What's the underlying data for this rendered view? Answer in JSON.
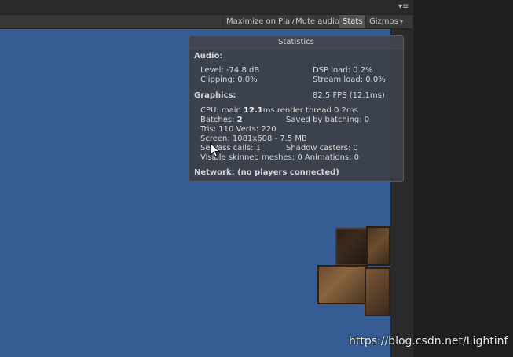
{
  "toolbar": {
    "maximize_label": "Maximize on Play",
    "mute_label": "Mute audio",
    "stats_label": "Stats",
    "gizmos_label": "Gizmos",
    "dropdown_glyph": "▾",
    "menu_glyph": "▾≡"
  },
  "stats": {
    "title": "Statistics",
    "audio": {
      "header": "Audio:",
      "level": "Level: -74.8 dB",
      "dsp": "DSP load: 0.2%",
      "clipping": "Clipping: 0.0%",
      "stream": "Stream load: 0.0%"
    },
    "graphics": {
      "header": "Graphics:",
      "fps": "82.5 FPS (12.1ms)",
      "cpu_prefix": "CPU: main ",
      "cpu_value": "12.1",
      "cpu_suffix": "ms  render thread 0.2ms",
      "batches_prefix": "Batches: ",
      "batches_value": "2",
      "saved": "Saved by batching: 0",
      "tris": "Tris: 110  Verts: 220",
      "screen": "Screen: 1081x608 - 7.5 MB",
      "setpass": "SetPass calls: 1",
      "shadow": "Shadow casters: 0",
      "skinned": "Visible skinned meshes: 0  Animations: 0"
    },
    "network": "Network: (no players connected)"
  },
  "watermark": "https://blog.csdn.net/Lightinf",
  "colors": {
    "viewport_bg": "#355d93",
    "panel_bg": "#3c4048",
    "toolbar_bg": "#383838"
  }
}
